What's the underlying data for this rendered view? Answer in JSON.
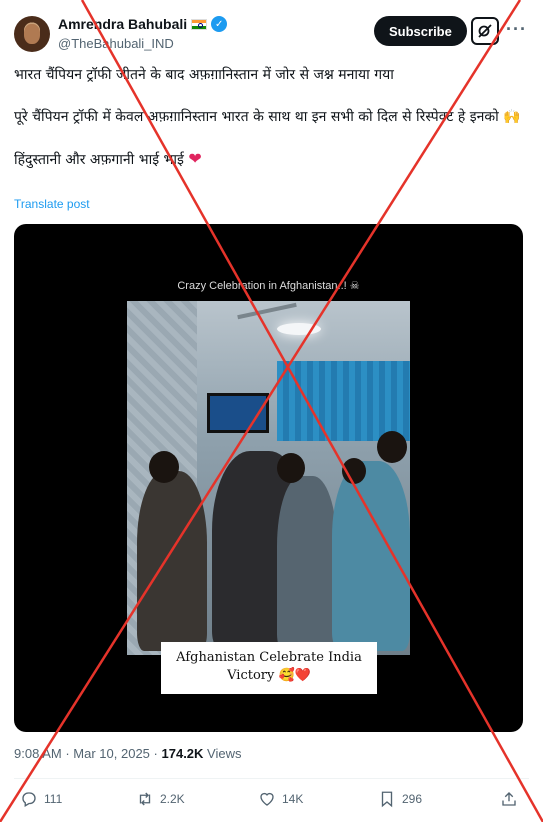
{
  "author": {
    "display_name": "Amrendra Bahubali",
    "handle": "@TheBahubali_IND",
    "flag_icon": "india-flag-icon",
    "verified_icon": "verified-badge-icon"
  },
  "header_buttons": {
    "subscribe_label": "Subscribe",
    "grok_icon": "grok-icon",
    "more_icon": "more-icon"
  },
  "tweet": {
    "line1": "भारत चैंपियन ट्रॉफी जीतने के बाद अफ़ग़ानिस्तान में जोर से जश्न मनाया गया",
    "line2": "पूरे चैंपियन ट्रॉफी में केवल अफ़ग़ानिस्तान भारत के साथ था इन सभी को दिल से रिस्पेक्ट हे इनको 🙌",
    "line3": "हिंदुस्तानी और अफ़गानी भाई भाई",
    "line3_emoji": "❤",
    "translate_label": "Translate post"
  },
  "media": {
    "top_caption": "Crazy Celebration in Afghanistan..! ☠",
    "bottom_caption_line1": "Afghanistan Celebrate India",
    "bottom_caption_line2": "Victory 🥰❤️"
  },
  "meta": {
    "time": "9:08 AM",
    "separator": "·",
    "date": "Mar 10, 2025",
    "views_count": "174.2K",
    "views_label": "Views"
  },
  "actions": {
    "reply_count": "111",
    "retweet_count": "2.2K",
    "like_count": "14K",
    "bookmark_count": "296"
  },
  "colors": {
    "accent": "#1d9bf0",
    "text": "#0f1419",
    "muted": "#536471",
    "cross": "#e5332a"
  }
}
